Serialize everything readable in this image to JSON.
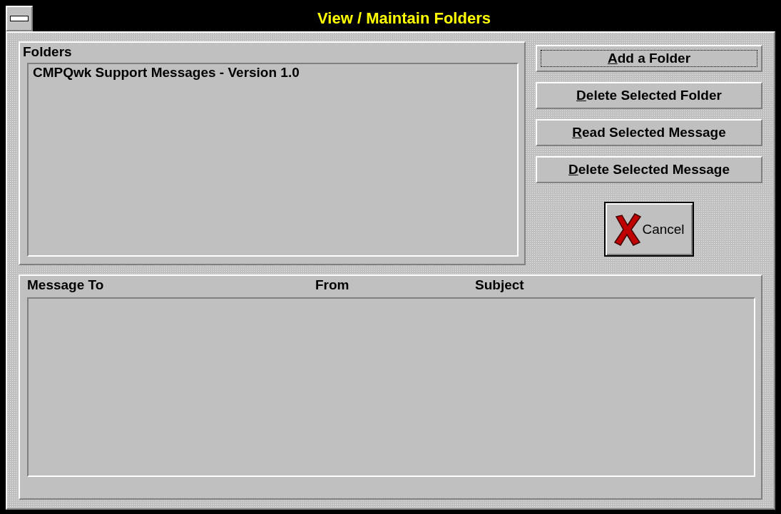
{
  "window": {
    "title": "View / Maintain Folders"
  },
  "folders": {
    "label": "Folders",
    "items": [
      {
        "label": "CMPQwk Support Messages - Version 1.0"
      }
    ]
  },
  "buttons": [
    {
      "key": "A",
      "rest": "dd a Folder",
      "focused": true
    },
    {
      "key": "D",
      "rest": "elete Selected Folder",
      "focused": false
    },
    {
      "key": "R",
      "rest": "ead Selected Message",
      "focused": false
    },
    {
      "key": "D",
      "rest": "elete Selected Message",
      "focused": false
    }
  ],
  "cancel_button": {
    "label": "Cancel"
  },
  "messages": {
    "columns": [
      "Message To",
      "From",
      "Subject"
    ]
  }
}
